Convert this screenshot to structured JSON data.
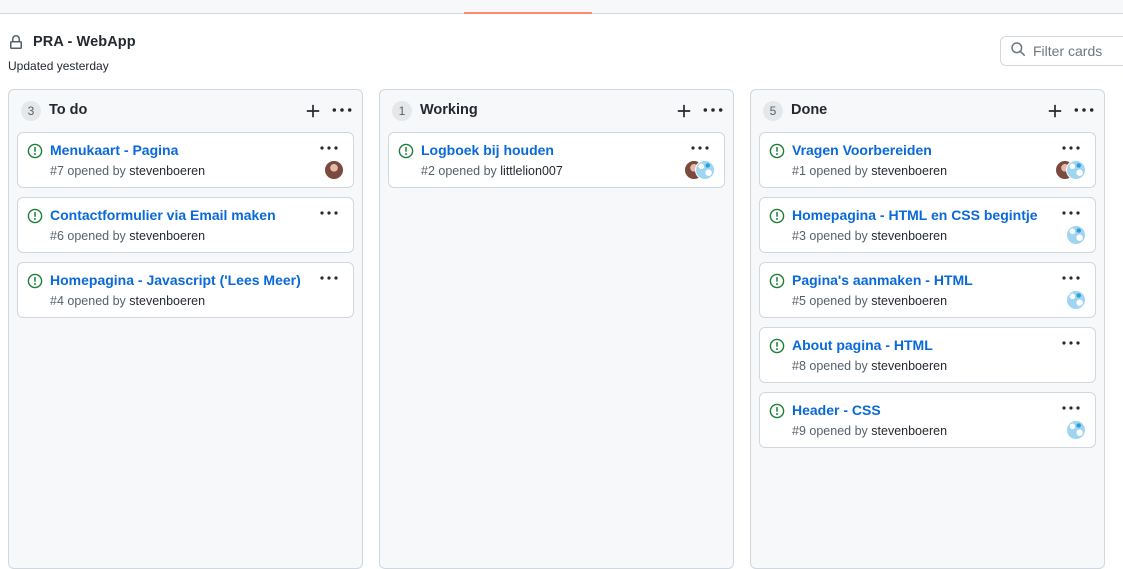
{
  "project": {
    "title": "PRA - WebApp",
    "updated": "Updated yesterday"
  },
  "filter": {
    "placeholder": "Filter cards"
  },
  "icons": {
    "lock": "lock-icon",
    "search": "search-icon",
    "plus": "plus-icon",
    "kebab": "kebab-horizontal-icon",
    "issue_open": "issue-opened-icon"
  },
  "colors": {
    "issue_open": "#1a7f37",
    "link": "#0969da",
    "tab_underline": "#fd8c73"
  },
  "columns": [
    {
      "name": "To do",
      "count": "3",
      "cards": [
        {
          "title": "Menukaart - Pagina",
          "number": "#7",
          "opened_by": "opened by",
          "author": "stevenboeren",
          "avatars": [
            "person"
          ]
        },
        {
          "title": "Contactformulier via Email maken",
          "number": "#6",
          "opened_by": "opened by",
          "author": "stevenboeren",
          "avatars": []
        },
        {
          "title": "Homepagina - Javascript ('Lees Meer)",
          "number": "#4",
          "opened_by": "opened by",
          "author": "stevenboeren",
          "avatars": []
        }
      ]
    },
    {
      "name": "Working",
      "count": "1",
      "cards": [
        {
          "title": "Logboek bij houden",
          "number": "#2",
          "opened_by": "opened by",
          "author": "littlelion007",
          "avatars": [
            "person",
            "identicon"
          ]
        }
      ]
    },
    {
      "name": "Done",
      "count": "5",
      "cards": [
        {
          "title": "Vragen Voorbereiden",
          "number": "#1",
          "opened_by": "opened by",
          "author": "stevenboeren",
          "avatars": [
            "person",
            "identicon"
          ]
        },
        {
          "title": "Homepagina - HTML en CSS begintje",
          "number": "#3",
          "opened_by": "opened by",
          "author": "stevenboeren",
          "avatars": [
            "identicon"
          ]
        },
        {
          "title": "Pagina's aanmaken - HTML",
          "number": "#5",
          "opened_by": "opened by",
          "author": "stevenboeren",
          "avatars": [
            "identicon"
          ]
        },
        {
          "title": "About pagina - HTML",
          "number": "#8",
          "opened_by": "opened by",
          "author": "stevenboeren",
          "avatars": []
        },
        {
          "title": "Header - CSS",
          "number": "#9",
          "opened_by": "opened by",
          "author": "stevenboeren",
          "avatars": [
            "identicon"
          ]
        }
      ]
    }
  ]
}
